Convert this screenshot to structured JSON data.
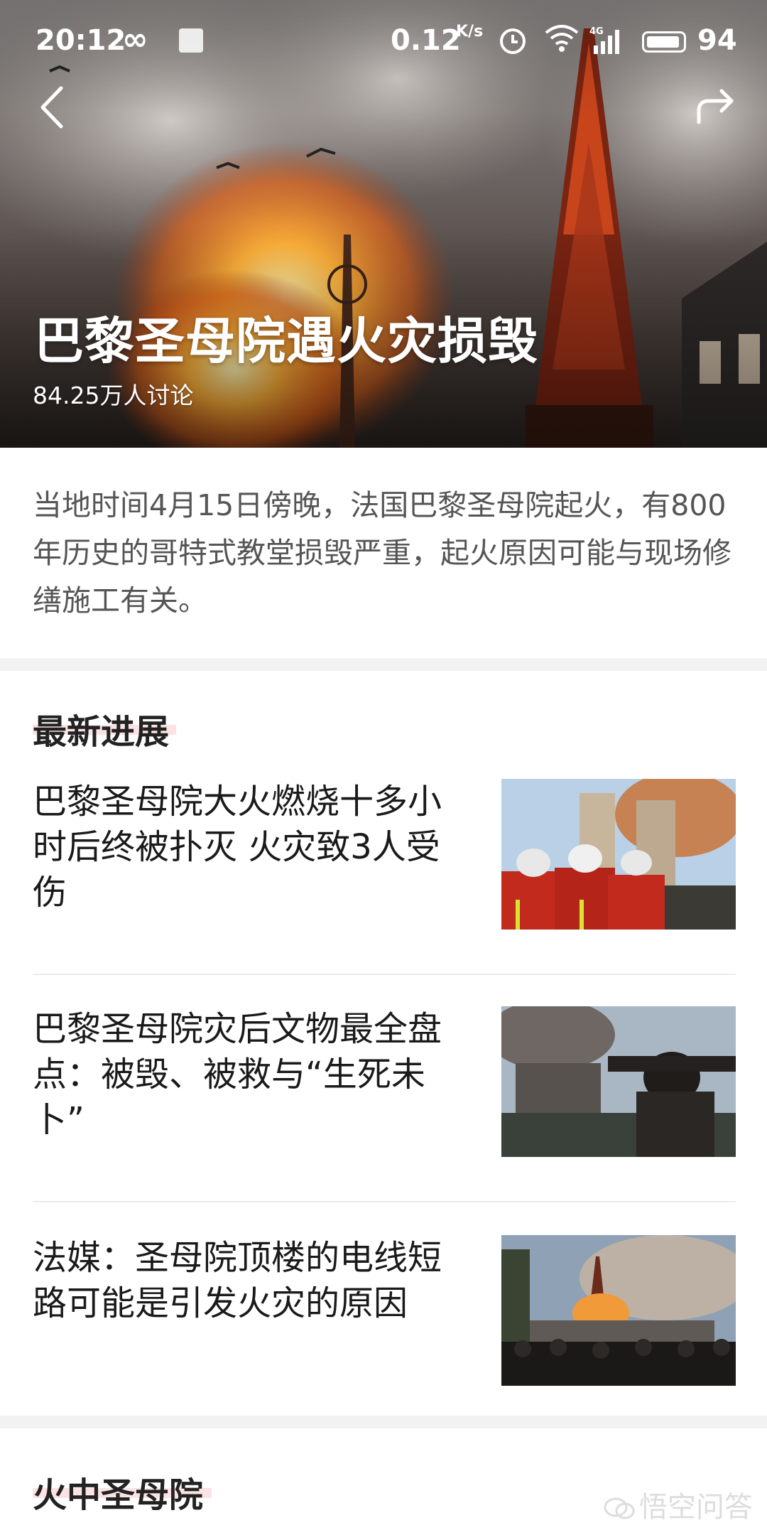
{
  "status_bar": {
    "time": "20:12",
    "loop_glyph": "∞",
    "network_speed": "0.12",
    "network_speed_unit": "K/s",
    "network_type": "4G",
    "battery_level": 94,
    "battery_text": "94"
  },
  "navigation": {
    "back_icon": "chevron-left-icon",
    "share_icon": "share-arrow-icon"
  },
  "topic": {
    "title": "巴黎圣母院遇火灾损毁",
    "discussion_count": "84.25万人讨论",
    "summary": "当地时间4月15日傍晚，法国巴黎圣母院起火，有800年历史的哥特式教堂损毁严重，起火原因可能与现场修缮施工有关。"
  },
  "latest": {
    "heading": "最新进展",
    "items": [
      {
        "title": "巴黎圣母院大火燃烧十多小时后终被扑灭 火灾致3人受伤",
        "thumbnail": "firefighters-photo"
      },
      {
        "title": "巴黎圣母院灾后文物最全盘点：被毁、被救与“生死未卜”",
        "thumbnail": "onlooker-photo"
      },
      {
        "title": "法媒：圣母院顶楼的电线短路可能是引发火灾的原因",
        "thumbnail": "crowd-photo"
      }
    ]
  },
  "next_section": {
    "heading": "火中圣母院"
  },
  "watermark": {
    "text": "悟空问答"
  },
  "colors": {
    "heading_highlight": "#fbe3e4",
    "summary_text": "#555555",
    "section_gap": "#f2f2f2"
  }
}
